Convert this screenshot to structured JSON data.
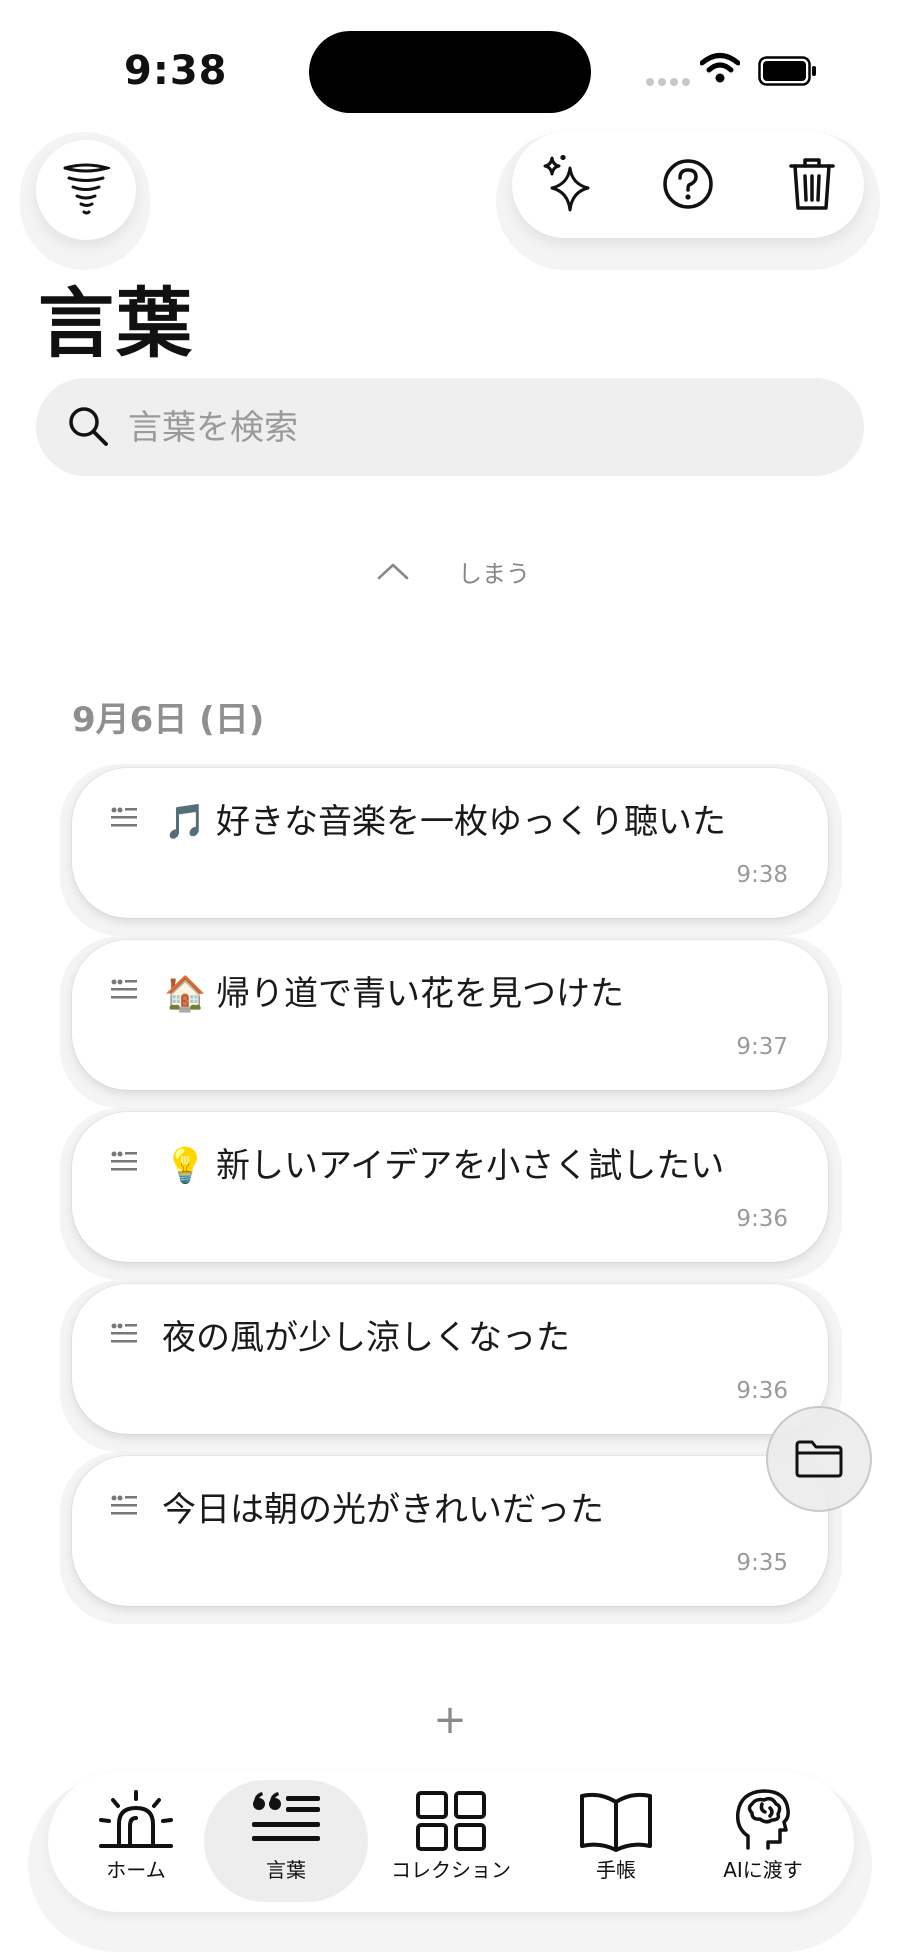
{
  "status_bar": {
    "time": "9:38"
  },
  "header": {
    "title": "言葉"
  },
  "search": {
    "placeholder": "言葉を検索"
  },
  "collapse": {
    "label": "しまう"
  },
  "section": {
    "date": "9月6日 (日)",
    "entries": [
      {
        "emoji": "🎵",
        "text": "好きな音楽を一枚ゆっくり聴いた",
        "time": "9:38"
      },
      {
        "emoji": "🏠",
        "text": "帰り道で青い花を見つけた",
        "time": "9:37"
      },
      {
        "emoji": "💡",
        "text": "新しいアイデアを小さく試したい",
        "time": "9:36"
      },
      {
        "emoji": "",
        "text": "夜の風が少し涼しくなった",
        "time": "9:36"
      },
      {
        "emoji": "",
        "text": "今日は朝の光がきれいだった",
        "time": "9:35"
      }
    ]
  },
  "add_button": {
    "label": "+"
  },
  "tabs": [
    {
      "label": "ホーム",
      "icon": "siren-icon"
    },
    {
      "label": "言葉",
      "icon": "quote-icon",
      "active": true
    },
    {
      "label": "コレクション",
      "icon": "grid-icon"
    },
    {
      "label": "手帳",
      "icon": "book-icon"
    },
    {
      "label": "AIに渡す",
      "icon": "brain-icon"
    }
  ]
}
